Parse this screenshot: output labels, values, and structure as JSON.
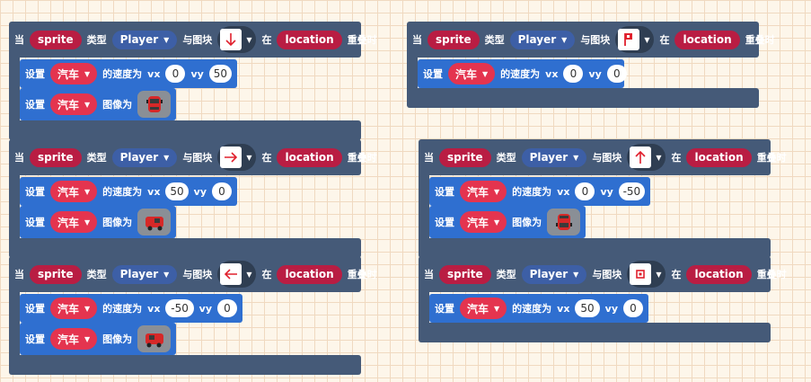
{
  "labels": {
    "when": "当",
    "type": "类型",
    "with_tile": "与图块",
    "at": "在",
    "overlap": "重叠时",
    "set": "设置",
    "velocity_prefix": "的速度为",
    "vx": "vx",
    "vy": "vy",
    "image_prefix": "图像为"
  },
  "events": [
    {
      "sprite": "sprite",
      "kind": "Player",
      "tile": "arrow-down",
      "location": "location",
      "car": "汽车",
      "vx": "0",
      "vy": "50",
      "image": "car-front-icon"
    },
    {
      "sprite": "sprite",
      "kind": "Player",
      "tile": "flag-p",
      "location": "location",
      "car": "汽车",
      "vx": "0",
      "vy": "0"
    },
    {
      "sprite": "sprite",
      "kind": "Player",
      "tile": "arrow-right",
      "location": "location",
      "car": "汽车",
      "vx": "50",
      "vy": "0",
      "image": "car-right-icon"
    },
    {
      "sprite": "sprite",
      "kind": "Player",
      "tile": "arrow-up",
      "location": "location",
      "car": "汽车",
      "vx": "0",
      "vy": "-50",
      "image": "car-back-icon"
    },
    {
      "sprite": "sprite",
      "kind": "Player",
      "tile": "arrow-left",
      "location": "location",
      "car": "汽车",
      "vx": "-50",
      "vy": "0",
      "image": "car-left-icon"
    },
    {
      "sprite": "sprite",
      "kind": "Player",
      "tile": "stop-square",
      "location": "location",
      "car": "汽车",
      "vx": "50",
      "vy": "0"
    }
  ],
  "colors": {
    "hat": "#455a78",
    "command": "#2f6fd0",
    "sprite_pill": "#b91d43",
    "kind_pill": "#3d5fa6",
    "car_pill": "#e4344f"
  }
}
